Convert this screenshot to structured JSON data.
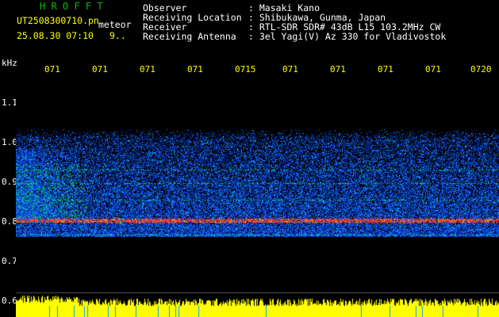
{
  "app": {
    "title": "H R O F F T",
    "filename": "UT2508300710.pn",
    "suffix": "meteor",
    "datetime": "25.08.30 07:10",
    "counter": "9.."
  },
  "info": {
    "observer_label": "Observer",
    "observer_value": ": Masaki Kano",
    "location_label": "Receiving Location",
    "location_value": ": Shibukawa, Gunma, Japan",
    "receiver_label": "Receiver",
    "receiver_value": ": RTL-SDR SDR# 43dB L15 103.2MHz CW",
    "antenna_label": "Receiving Antenna",
    "antenna_value": ": 3el Yagi(V) Az 330 for Vladivostok"
  },
  "axis": {
    "unit": "kHz",
    "y_labels": [
      "1.1",
      "1.0",
      "0.9",
      "0.8",
      "0.7",
      "0.6"
    ],
    "time_ticks": [
      "071",
      "071",
      "071",
      "071",
      "0715",
      "071",
      "071",
      "071",
      "071",
      "0720"
    ]
  },
  "colors": {
    "background": "#000000",
    "title_green": "#00c000",
    "tick_yellow": "#ffff00",
    "signal_red": "#ff2020",
    "noise_blue": "#1040ff",
    "power_yellow": "#ffff00"
  }
}
